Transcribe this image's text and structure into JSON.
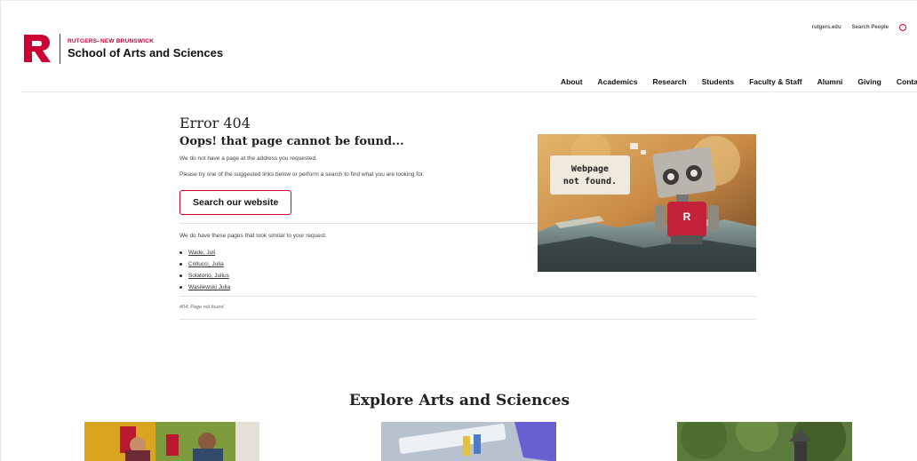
{
  "brand": {
    "university": "RUTGERS–NEW BRUNSWICK",
    "school": "School of Arts and Sciences",
    "color": "#cc0033"
  },
  "utility": {
    "links": [
      "rutgers.edu",
      "Search People"
    ],
    "icon": "search-icon"
  },
  "nav": {
    "items": [
      "About",
      "Academics",
      "Research",
      "Students",
      "Faculty & Staff",
      "Alumni",
      "Giving",
      "Contac"
    ]
  },
  "error": {
    "title": "Error 404",
    "subtitle": "Oops! that page cannot be found...",
    "message1": "We do not have a page at the address you requested.",
    "message2": "Please try one of the suggested links below or perform a search to find what you are looking for.",
    "search_button": "Search our website",
    "similar_intro": "We do have these pages that look similar to your request.",
    "similar_links": [
      "Wade, Juli",
      "Collucci, Julia",
      "Solatorio, Julius",
      "Wasilewski Julia"
    ],
    "breadcrumb": "404: Page not found"
  },
  "hero_image": {
    "sign_line1": "Webpage",
    "sign_line2": "not found.",
    "robot_badge": "R"
  },
  "explore": {
    "title": "Explore Arts and Sciences"
  }
}
